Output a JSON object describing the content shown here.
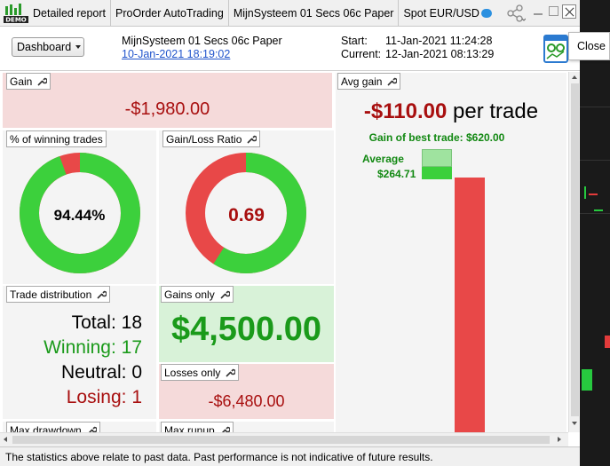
{
  "tabs": [
    {
      "label": "Detailed report"
    },
    {
      "label": "ProOrder AutoTrading"
    },
    {
      "label": "MijnSysteem 01 Secs 06c Paper"
    },
    {
      "label": "Spot EUR/USD"
    }
  ],
  "logo_text": "DEMO",
  "tooltip": {
    "close": "Close"
  },
  "header": {
    "dashboard_label": "Dashboard",
    "system_name": "MijnSysteem 01 Secs 06c Paper",
    "system_date": "10-Jan-2021 18:19:02",
    "start_label": "Start:",
    "start_value": "11-Jan-2021 11:24:28",
    "current_label": "Current:",
    "current_value": "12-Jan-2021 08:13:29"
  },
  "panels": {
    "gain": {
      "title": "Gain",
      "value": "-$1,980.00"
    },
    "win_pct": {
      "title": "% of winning trades",
      "value": "94.44%",
      "fraction": 0.9444
    },
    "gl_ratio": {
      "title": "Gain/Loss Ratio",
      "value": "0.69",
      "fraction": 0.59
    },
    "avg_gain": {
      "title": "Avg gain",
      "value": "-$110.00",
      "suffix": "per trade",
      "best_trade": "Gain of best trade: $620.00",
      "average_label": "Average",
      "average_value": "$264.71"
    },
    "trade_dist": {
      "title": "Trade distribution",
      "rows": [
        {
          "label": "Total:",
          "value": "18",
          "color": "#000000"
        },
        {
          "label": "Winning:",
          "value": "17",
          "color": "#1a9a1a"
        },
        {
          "label": "Neutral:",
          "value": "0",
          "color": "#000000"
        },
        {
          "label": "Losing:",
          "value": "1",
          "color": "#a80f0f"
        }
      ]
    },
    "gains_only": {
      "title": "Gains only",
      "value": "$4,500.00"
    },
    "losses_only": {
      "title": "Losses only",
      "value": "-$6,480.00"
    },
    "max_drawdown": {
      "title": "Max drawdown"
    },
    "max_runup": {
      "title": "Max runup"
    }
  },
  "colors": {
    "win": "#3cd03c",
    "loss": "#e84848",
    "neg_text": "#a80f0f",
    "pos_text": "#1a9a1a"
  },
  "footer": {
    "text": "The statistics above relate to past data. Past performance is not indicative of future results."
  }
}
